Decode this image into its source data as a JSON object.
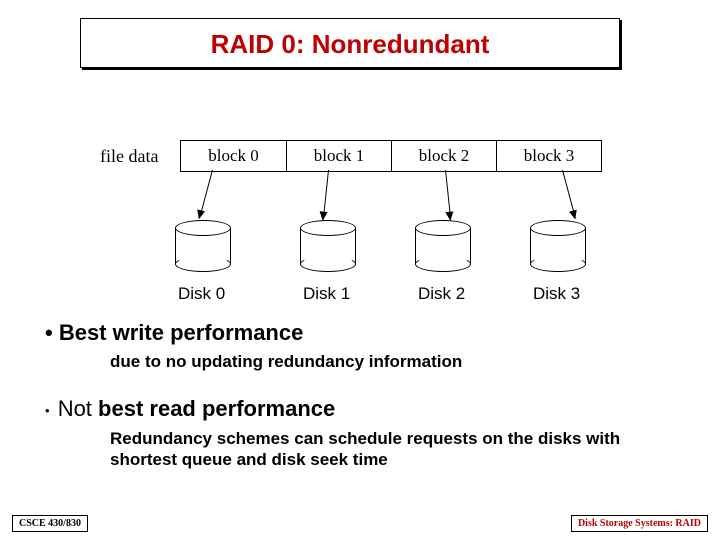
{
  "title": "RAID 0: Nonredundant",
  "fileLabel": "file data",
  "blocks": [
    "block 0",
    "block 1",
    "block 2",
    "block 3"
  ],
  "disks": [
    "Disk 0",
    "Disk 1",
    "Disk 2",
    "Disk 3"
  ],
  "bullet1": "• Best write performance",
  "bullet1sub": "due to no updating redundancy information",
  "bullet2dot": "•",
  "bullet2a": "Not ",
  "bullet2b": "best read performance",
  "bullet2sub": "Redundancy schemes can schedule requests on the disks with shortest queue and disk seek time",
  "footerLeft": "CSCE 430/830",
  "footerRight": "Disk Storage Systems: RAID"
}
